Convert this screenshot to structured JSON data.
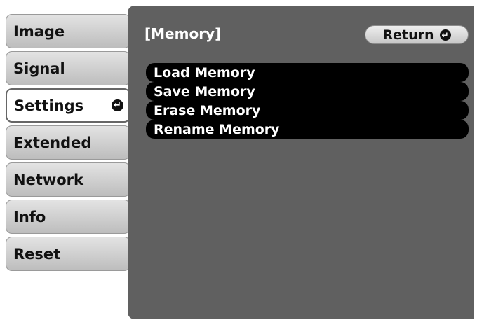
{
  "menu": {
    "items": [
      {
        "label": "Image"
      },
      {
        "label": "Signal"
      },
      {
        "label": "Settings"
      },
      {
        "label": "Extended"
      },
      {
        "label": "Network"
      },
      {
        "label": "Info"
      },
      {
        "label": "Reset"
      }
    ],
    "selected": "Settings"
  },
  "panel": {
    "title": "[Memory]",
    "return_label": "Return",
    "options": [
      {
        "label": "Load Memory"
      },
      {
        "label": "Save Memory"
      },
      {
        "label": "Erase Memory"
      },
      {
        "label": "Rename Memory"
      }
    ]
  },
  "icons": {
    "enter": "enter-icon",
    "enter_glyph": "↵"
  },
  "colors": {
    "panel_bg": "#606060",
    "option_bg": "#000000",
    "menu_bg": "#d5d5d5",
    "text_light": "#ffffff",
    "text_dark": "#111111"
  }
}
